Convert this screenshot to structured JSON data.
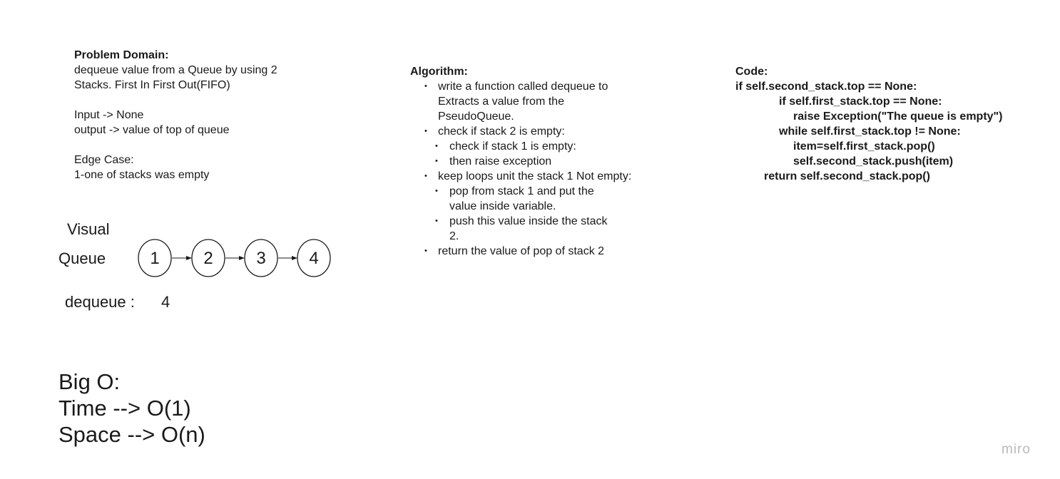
{
  "problem": {
    "heading": "Problem Domain:",
    "lines": [
      "dequeue value from a Queue by using 2",
      "Stacks. First In First Out(FIFO)"
    ],
    "input": "Input -> None",
    "output": "output -> value of top of queue",
    "edge_heading": "Edge Case:",
    "edge_text": "1-one of stacks was empty"
  },
  "algorithm": {
    "heading": "Algorithm:",
    "step1": [
      "write a function called dequeue to",
      "Extracts a value from the",
      "PseudoQueue."
    ],
    "step2": "check if stack 2 is empty:",
    "step2_sub1": "check if stack 1 is empty:",
    "step2_sub2": "then raise exception",
    "step3": "keep loops unit the stack 1 Not empty:",
    "step3_sub1": [
      "pop from stack 1 and put the",
      "value inside variable."
    ],
    "step3_sub2": [
      "push this value inside the stack",
      "2."
    ],
    "step4": "return the value of pop of stack 2"
  },
  "code": {
    "heading": "Code:",
    "lines": [
      "if self.second_stack.top == None:",
      "if self.first_stack.top == None:",
      "raise Exception(\"The queue is empty\")",
      "while self.first_stack.top != None:",
      "item=self.first_stack.pop()",
      "self.second_stack.push(item)",
      "return self.second_stack.pop()"
    ]
  },
  "visual": {
    "title": "Visual",
    "queue_label": "Queue",
    "nodes": [
      "1",
      "2",
      "3",
      "4"
    ],
    "dequeue_label": "dequeue :",
    "dequeue_value": "4"
  },
  "big_o": {
    "heading": "Big O:",
    "time": "Time --> O(1)",
    "space": "Space --> O(n)"
  },
  "watermark": "miro",
  "colors": {
    "text": "#1a1a1a",
    "watermark": "#b9b9b9",
    "stroke": "#1a1a1a"
  }
}
